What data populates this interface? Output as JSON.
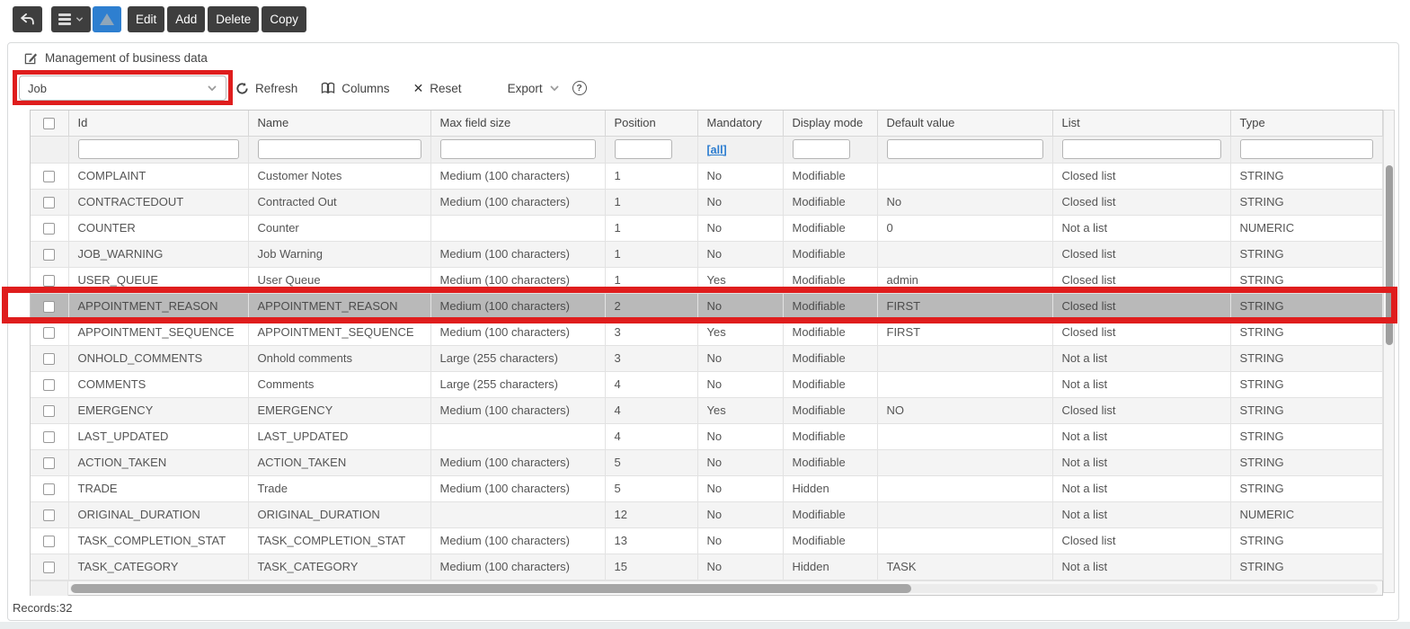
{
  "toolbar": {
    "edit": "Edit",
    "add": "Add",
    "delete": "Delete",
    "copy": "Copy"
  },
  "panel": {
    "title": "Management of business data"
  },
  "controls": {
    "entity_value": "Job",
    "refresh": "Refresh",
    "columns": "Columns",
    "reset": "Reset",
    "export": "Export",
    "help": "?"
  },
  "table": {
    "headers": {
      "id": "Id",
      "name": "Name",
      "max_field_size": "Max field size",
      "position": "Position",
      "mandatory": "Mandatory",
      "display_mode": "Display mode",
      "default_value": "Default value",
      "list": "List",
      "type": "Type"
    },
    "filter_all": "[all]",
    "rows": [
      {
        "id": "COMPLAINT",
        "name": "Customer Notes",
        "max_field_size": "Medium (100 characters)",
        "position": "1",
        "mandatory": "No",
        "display_mode": "Modifiable",
        "default_value": "",
        "list": "Closed list",
        "type": "STRING",
        "selected": false
      },
      {
        "id": "CONTRACTEDOUT",
        "name": "Contracted Out",
        "max_field_size": "Medium (100 characters)",
        "position": "1",
        "mandatory": "No",
        "display_mode": "Modifiable",
        "default_value": "No",
        "list": "Closed list",
        "type": "STRING",
        "selected": false
      },
      {
        "id": "COUNTER",
        "name": "Counter",
        "max_field_size": "",
        "position": "1",
        "mandatory": "No",
        "display_mode": "Modifiable",
        "default_value": "0",
        "list": "Not a list",
        "type": "NUMERIC",
        "selected": false
      },
      {
        "id": "JOB_WARNING",
        "name": "Job Warning",
        "max_field_size": "Medium (100 characters)",
        "position": "1",
        "mandatory": "No",
        "display_mode": "Modifiable",
        "default_value": "",
        "list": "Closed list",
        "type": "STRING",
        "selected": false
      },
      {
        "id": "USER_QUEUE",
        "name": "User Queue",
        "max_field_size": "Medium (100 characters)",
        "position": "1",
        "mandatory": "Yes",
        "display_mode": "Modifiable",
        "default_value": "admin",
        "list": "Closed list",
        "type": "STRING",
        "selected": false
      },
      {
        "id": "APPOINTMENT_REASON",
        "name": "APPOINTMENT_REASON",
        "max_field_size": "Medium (100 characters)",
        "position": "2",
        "mandatory": "No",
        "display_mode": "Modifiable",
        "default_value": "FIRST",
        "list": "Closed list",
        "type": "STRING",
        "selected": true
      },
      {
        "id": "APPOINTMENT_SEQUENCE",
        "name": "APPOINTMENT_SEQUENCE",
        "max_field_size": "Medium (100 characters)",
        "position": "3",
        "mandatory": "Yes",
        "display_mode": "Modifiable",
        "default_value": "FIRST",
        "list": "Closed list",
        "type": "STRING",
        "selected": false
      },
      {
        "id": "ONHOLD_COMMENTS",
        "name": "Onhold comments",
        "max_field_size": "Large (255 characters)",
        "position": "3",
        "mandatory": "No",
        "display_mode": "Modifiable",
        "default_value": "",
        "list": "Not a list",
        "type": "STRING",
        "selected": false
      },
      {
        "id": "COMMENTS",
        "name": "Comments",
        "max_field_size": "Large (255 characters)",
        "position": "4",
        "mandatory": "No",
        "display_mode": "Modifiable",
        "default_value": "",
        "list": "Not a list",
        "type": "STRING",
        "selected": false
      },
      {
        "id": "EMERGENCY",
        "name": "EMERGENCY",
        "max_field_size": "Medium (100 characters)",
        "position": "4",
        "mandatory": "Yes",
        "display_mode": "Modifiable",
        "default_value": "NO",
        "list": "Closed list",
        "type": "STRING",
        "selected": false
      },
      {
        "id": "LAST_UPDATED",
        "name": "LAST_UPDATED",
        "max_field_size": "",
        "position": "4",
        "mandatory": "No",
        "display_mode": "Modifiable",
        "default_value": "",
        "list": "Not a list",
        "type": "STRING",
        "selected": false
      },
      {
        "id": "ACTION_TAKEN",
        "name": "ACTION_TAKEN",
        "max_field_size": "Medium (100 characters)",
        "position": "5",
        "mandatory": "No",
        "display_mode": "Modifiable",
        "default_value": "",
        "list": "Not a list",
        "type": "STRING",
        "selected": false
      },
      {
        "id": "TRADE",
        "name": "Trade",
        "max_field_size": "Medium (100 characters)",
        "position": "5",
        "mandatory": "No",
        "display_mode": "Hidden",
        "default_value": "",
        "list": "Not a list",
        "type": "STRING",
        "selected": false
      },
      {
        "id": "ORIGINAL_DURATION",
        "name": "ORIGINAL_DURATION",
        "max_field_size": "",
        "position": "12",
        "mandatory": "No",
        "display_mode": "Modifiable",
        "default_value": "",
        "list": "Not a list",
        "type": "NUMERIC",
        "selected": false
      },
      {
        "id": "TASK_COMPLETION_STAT",
        "name": "TASK_COMPLETION_STAT",
        "max_field_size": "Medium (100 characters)",
        "position": "13",
        "mandatory": "No",
        "display_mode": "Modifiable",
        "default_value": "",
        "list": "Closed list",
        "type": "STRING",
        "selected": false
      },
      {
        "id": "TASK_CATEGORY",
        "name": "TASK_CATEGORY",
        "max_field_size": "Medium (100 characters)",
        "position": "15",
        "mandatory": "No",
        "display_mode": "Hidden",
        "default_value": "TASK",
        "list": "Not a list",
        "type": "STRING",
        "selected": false
      }
    ]
  },
  "footer": {
    "records": "Records:32"
  },
  "colors": {
    "accent_blue": "#2e7fd0",
    "annotation_red": "#df1d1d",
    "selected_row_bg": "#b9b9b9"
  }
}
